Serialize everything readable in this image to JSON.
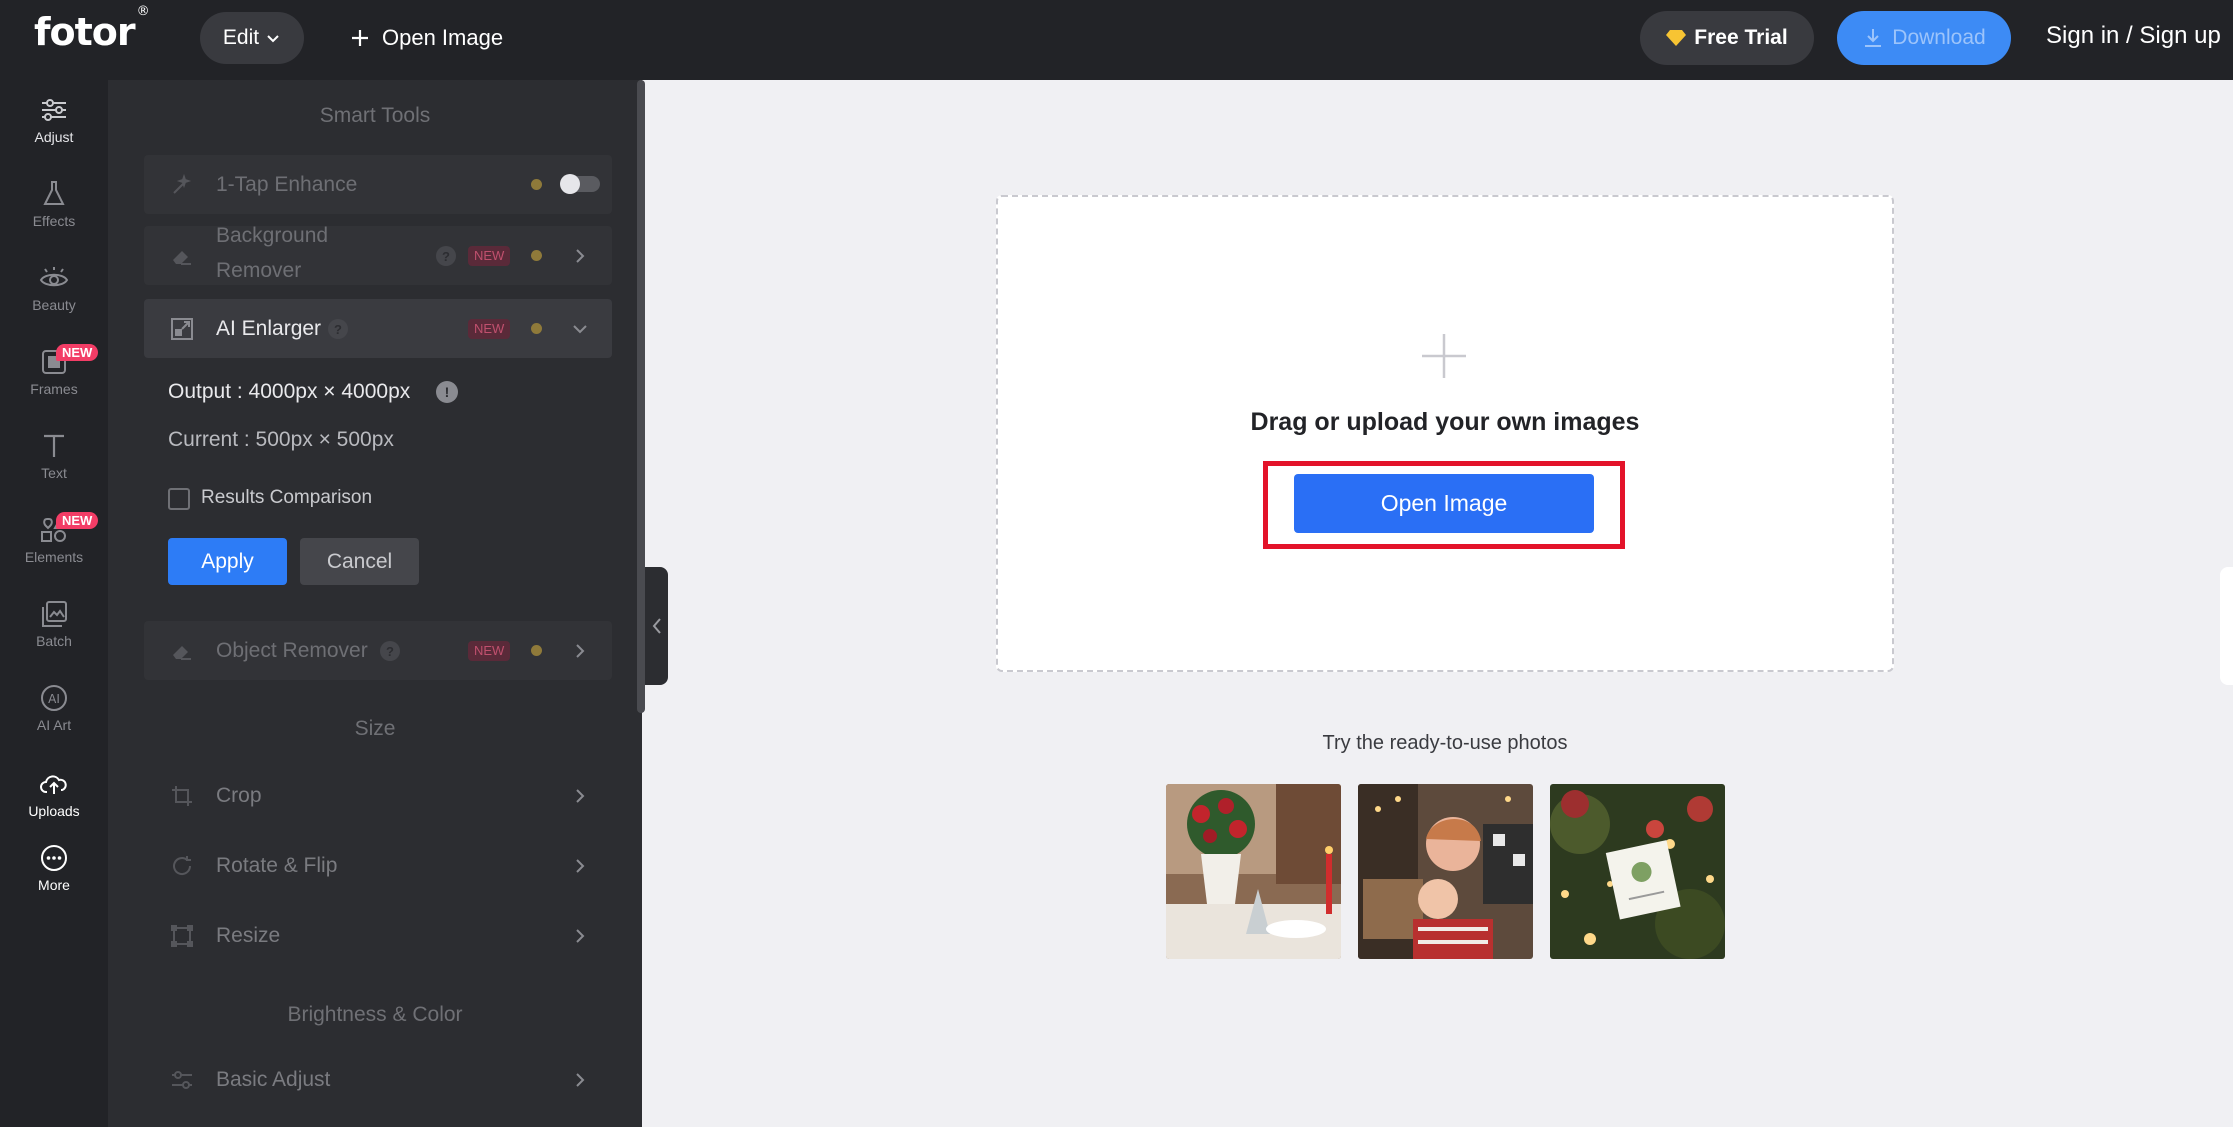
{
  "topbar": {
    "logo_text": "fotor",
    "logo_mark": "®",
    "edit_label": "Edit",
    "open_image_label": "Open Image",
    "free_trial_label": "Free Trial",
    "download_label": "Download",
    "signin_label": "Sign in / Sign up"
  },
  "rail": [
    {
      "label": "Adjust",
      "icon": "sliders-icon"
    },
    {
      "label": "Effects",
      "icon": "flask-icon"
    },
    {
      "label": "Beauty",
      "icon": "eye-icon"
    },
    {
      "label": "Frames",
      "icon": "frame-icon",
      "badge": "NEW"
    },
    {
      "label": "Text",
      "icon": "text-icon"
    },
    {
      "label": "Elements",
      "icon": "shapes-icon",
      "badge": "NEW"
    },
    {
      "label": "Batch",
      "icon": "batch-icon"
    },
    {
      "label": "AI Art",
      "icon": "ai-icon"
    },
    {
      "label": "Uploads",
      "icon": "cloud-upload-icon"
    },
    {
      "label": "More",
      "icon": "more-icon"
    }
  ],
  "panel": {
    "smart_tools_title": "Smart Tools",
    "one_tap": "1-Tap Enhance",
    "bg_remover_line1": "Background",
    "bg_remover_line2": "Remover",
    "ai_enlarger": "AI Enlarger",
    "new_badge": "NEW",
    "help_mark": "?",
    "info_mark": "!",
    "output_text": "Output : 4000px × 4000px",
    "current_text": "Current : 500px × 500px",
    "results_comparison": "Results Comparison",
    "apply": "Apply",
    "cancel": "Cancel",
    "object_remover": "Object Remover",
    "size_title": "Size",
    "crop": "Crop",
    "rotate_flip": "Rotate & Flip",
    "resize": "Resize",
    "brightness_title": "Brightness & Color",
    "basic_adjust": "Basic Adjust"
  },
  "canvas": {
    "drop_title": "Drag or upload your own images",
    "open_image_button": "Open Image",
    "try_title": "Try the ready-to-use photos"
  },
  "colors": {
    "accent": "#2a6ff5",
    "highlight_frame": "#e3132a",
    "badge": "#f33d66"
  }
}
